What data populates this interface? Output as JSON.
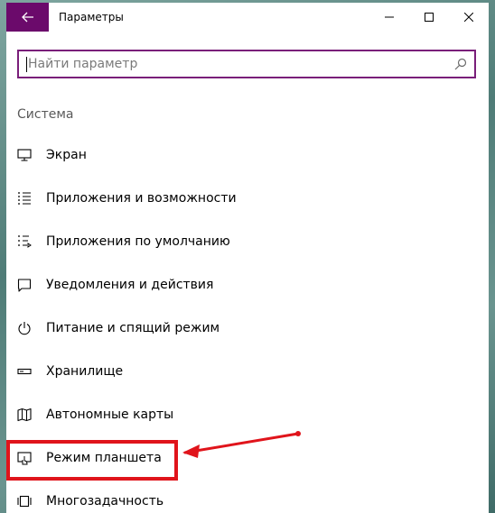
{
  "window": {
    "title": "Параметры"
  },
  "search": {
    "placeholder": "Найти параметр",
    "value": ""
  },
  "section": {
    "title": "Система"
  },
  "nav_items": [
    {
      "label": "Экран",
      "icon": "monitor-icon"
    },
    {
      "label": "Приложения и возможности",
      "icon": "list-icon"
    },
    {
      "label": "Приложения по умолчанию",
      "icon": "default-apps-icon"
    },
    {
      "label": "Уведомления и действия",
      "icon": "notification-icon"
    },
    {
      "label": "Питание и спящий режим",
      "icon": "power-icon"
    },
    {
      "label": "Хранилище",
      "icon": "storage-icon"
    },
    {
      "label": "Автономные карты",
      "icon": "map-icon"
    },
    {
      "label": "Режим планшета",
      "icon": "tablet-mode-icon"
    },
    {
      "label": "Многозадачность",
      "icon": "multitasking-icon"
    }
  ],
  "colors": {
    "accent": "#6b0a6b",
    "highlight": "#e0141b"
  }
}
